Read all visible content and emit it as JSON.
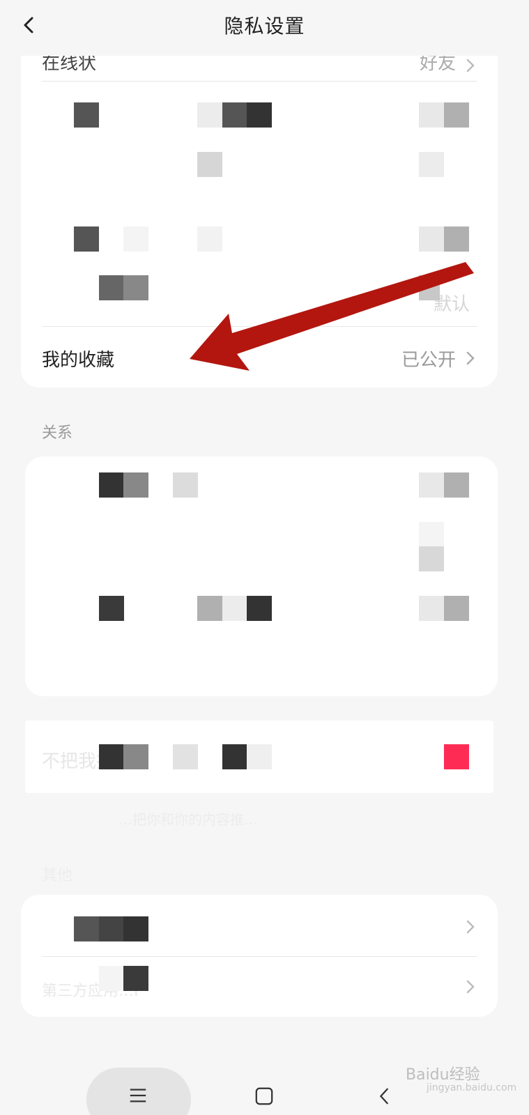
{
  "header": {
    "title": "隐私设置"
  },
  "card1": {
    "row_top_label": "在线状",
    "row_top_value": "好友",
    "row_faint_value": "默认",
    "favorites_label": "我的收藏",
    "favorites_value": "已公开"
  },
  "section_relations": {
    "label": "关系"
  },
  "card3": {
    "row_label": "不把我推",
    "caption": "…把你和你的内容推…"
  },
  "section_other": {
    "label": "其他"
  },
  "card4": {
    "row2_label": "第三方应用…F"
  },
  "watermark": {
    "brand": "Baidu经验",
    "url": "jingyan.baidu.com"
  },
  "colors": {
    "toggle_on": "#fe2c55",
    "annotation_arrow": "#b3160f"
  },
  "icons": {
    "back": "chevron-left-icon",
    "chevron": "chevron-right-icon",
    "nav_menu": "menu-icon",
    "nav_home": "square-icon",
    "nav_back": "triangle-back-icon"
  }
}
